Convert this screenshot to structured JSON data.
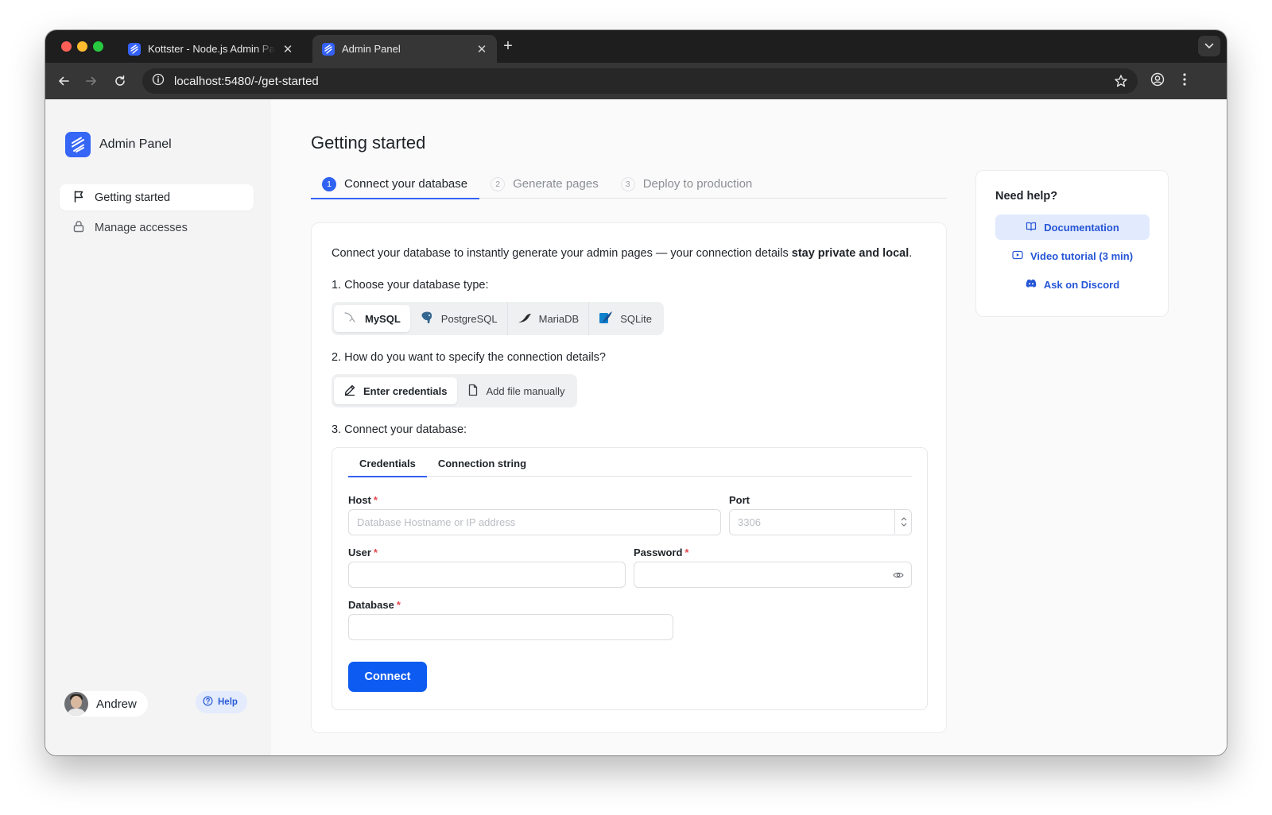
{
  "browser": {
    "tabs": [
      {
        "title": "Kottster - Node.js Admin Panel",
        "active": false
      },
      {
        "title": "Admin Panel",
        "active": true
      }
    ],
    "url": "localhost:5480/-/get-started"
  },
  "sidebar": {
    "brand": "Admin Panel",
    "items": [
      {
        "label": "Getting started",
        "icon": "flag-icon",
        "active": true
      },
      {
        "label": "Manage accesses",
        "icon": "lock-icon",
        "active": false
      }
    ],
    "user": {
      "name": "Andrew"
    },
    "help_label": "Help"
  },
  "main": {
    "title": "Getting started",
    "steps": [
      {
        "num": "1",
        "label": "Connect your database",
        "active": true
      },
      {
        "num": "2",
        "label": "Generate pages",
        "active": false
      },
      {
        "num": "3",
        "label": "Deploy to production",
        "active": false
      }
    ],
    "intro_prefix": "Connect your database to instantly generate your admin pages — your connection details ",
    "intro_bold": "stay private and local",
    "intro_suffix": ".",
    "q1": "1. Choose your database type:",
    "db_types": [
      {
        "label": "MySQL",
        "selected": true
      },
      {
        "label": "PostgreSQL",
        "selected": false
      },
      {
        "label": "MariaDB",
        "selected": false
      },
      {
        "label": "SQLite",
        "selected": false
      }
    ],
    "q2": "2. How do you want to specify the connection details?",
    "methods": [
      {
        "label": "Enter credentials",
        "selected": true
      },
      {
        "label": "Add file manually",
        "selected": false
      }
    ],
    "q3": "3. Connect your database:",
    "subtabs": [
      {
        "label": "Credentials",
        "active": true
      },
      {
        "label": "Connection string",
        "active": false
      }
    ],
    "fields": {
      "host": {
        "label": "Host",
        "placeholder": "Database Hostname or IP address",
        "value": ""
      },
      "port": {
        "label": "Port",
        "placeholder": "3306",
        "value": ""
      },
      "user": {
        "label": "User",
        "value": ""
      },
      "password": {
        "label": "Password",
        "value": ""
      },
      "database": {
        "label": "Database",
        "value": ""
      }
    },
    "required_mark": "*",
    "connect_label": "Connect"
  },
  "help": {
    "title": "Need help?",
    "links": [
      {
        "label": "Documentation",
        "icon": "book-icon"
      },
      {
        "label": "Video tutorial (3 min)",
        "icon": "video-icon"
      },
      {
        "label": "Ask on Discord",
        "icon": "discord-icon"
      }
    ]
  },
  "colors": {
    "accent": "#0d5bf0",
    "brand": "#3566f5",
    "required": "#e5484d"
  }
}
